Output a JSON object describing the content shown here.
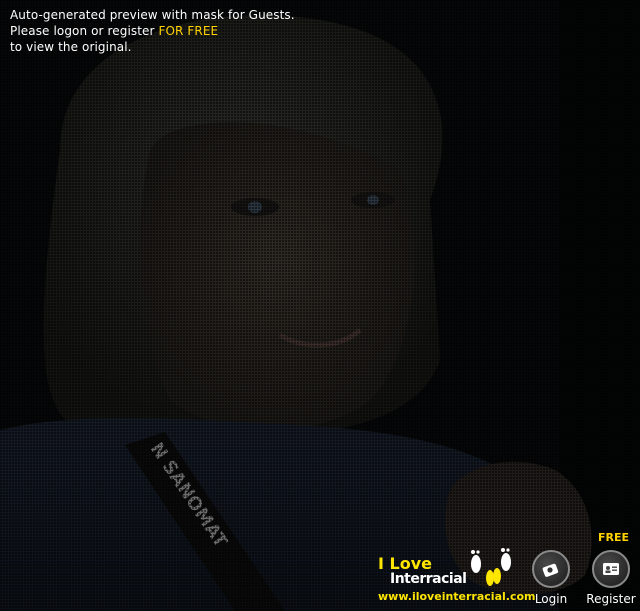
{
  "notice": {
    "line1": "Auto-generated preview with mask for Guests.",
    "line2_prefix": "Please logon or register ",
    "line2_highlight": "FOR FREE",
    "line3": "to view the original."
  },
  "brand": {
    "line1": "I Love",
    "line2": "Interracial",
    "url": "www.iloveinterracial.com"
  },
  "actions": {
    "login_label": "Login",
    "register_label": "Register",
    "free_tag": "FREE"
  },
  "photo": {
    "badge_text": "N SANOMAT"
  },
  "colors": {
    "accent_yellow": "#ffd200",
    "text_white": "#ffffff",
    "background": "#000000"
  },
  "icons": {
    "login": "camera-icon",
    "register": "id-card-icon",
    "brand": "footprints-icon"
  }
}
